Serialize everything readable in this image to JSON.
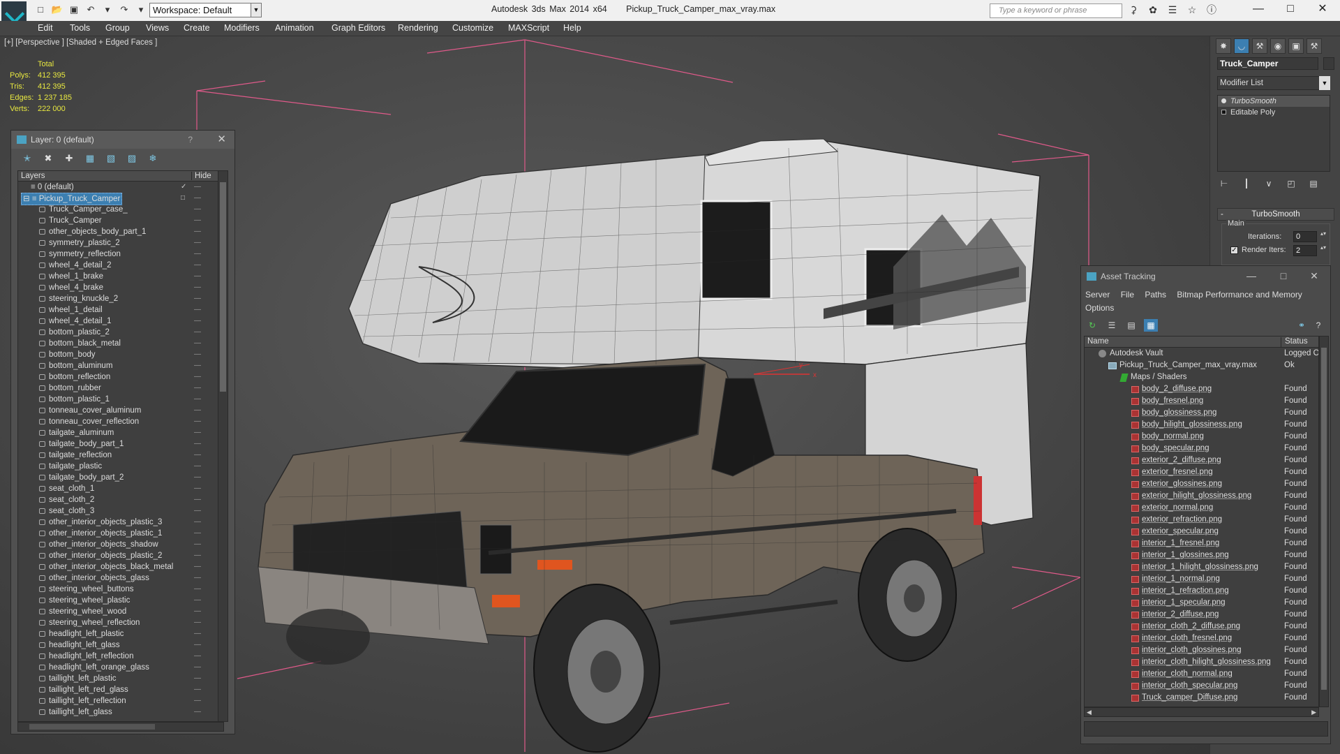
{
  "titlebar": {
    "workspace_label": "Workspace: Default",
    "app_name": "Autodesk 3ds Max  2014 x64",
    "file_name": "Pickup_Truck_Camper_max_vray.max",
    "search_placeholder": "Type a keyword or phrase"
  },
  "menu": [
    "Edit",
    "Tools",
    "Group",
    "Views",
    "Create",
    "Modifiers",
    "Animation",
    "Graph Editors",
    "Rendering",
    "Customize",
    "MAXScript",
    "Help"
  ],
  "viewport": {
    "label": "[+] [Perspective ] [Shaded + Edged Faces ]",
    "stats": {
      "header": "Total",
      "polys_label": "Polys:",
      "polys": "412 395",
      "tris_label": "Tris:",
      "tris": "412 395",
      "edges_label": "Edges:",
      "edges": "1 237 185",
      "verts_label": "Verts:",
      "verts": "222 000"
    },
    "colors": {
      "bbox": "#e05a8a",
      "body": "#6e6458",
      "camper": "#d8d8d8",
      "wire": "#2a2a2a"
    }
  },
  "layer_window": {
    "title": "Layer: 0 (default)",
    "help": "?",
    "col_layers": "Layers",
    "col_hide": "Hide",
    "default_layer": "0 (default)",
    "selected_layer": "Pickup_Truck_Camper",
    "objects": [
      "Truck_Camper_case_",
      "Truck_Camper",
      "other_objects_body_part_1",
      "symmetry_plastic_2",
      "symmetry_reflection",
      "wheel_4_detail_2",
      "wheel_1_brake",
      "wheel_4_brake",
      "steering_knuckle_2",
      "wheel_1_detail",
      "wheel_4_detail_1",
      "bottom_plastic_2",
      "bottom_black_metal",
      "bottom_body",
      "bottom_aluminum",
      "bottom_reflection",
      "bottom_rubber",
      "bottom_plastic_1",
      "tonneau_cover_aluminum",
      "tonneau_cover_reflection",
      "tailgate_aluminum",
      "tailgate_body_part_1",
      "tailgate_reflection",
      "tailgate_plastic",
      "tailgate_body_part_2",
      "seat_cloth_1",
      "seat_cloth_2",
      "seat_cloth_3",
      "other_interior_objects_plastic_3",
      "other_interior_objects_plastic_1",
      "other_interior_objects_shadow",
      "other_interior_objects_plastic_2",
      "other_interior_objects_black_metal",
      "other_interior_objects_glass",
      "steering_wheel_buttons",
      "steering_wheel_plastic",
      "steering_wheel_wood",
      "steering_wheel_reflection",
      "headlight_left_plastic",
      "headlight_left_glass",
      "headlight_left_reflection",
      "headlight_left_orange_glass",
      "taillight_left_plastic",
      "taillight_left_red_glass",
      "taillight_left_reflection",
      "taillight_left_glass"
    ]
  },
  "command_panel": {
    "object_name": "Truck_Camper",
    "modifier_list": "Modifier List",
    "stack": [
      "TurboSmooth",
      "Editable Poly"
    ],
    "rollout_title": "TurboSmooth",
    "group_main": "Main",
    "iterations_label": "Iterations:",
    "iterations_value": "0",
    "render_iters_label": "Render Iters:",
    "render_iters_value": "2"
  },
  "asset_tracking": {
    "title": "Asset Tracking",
    "menu": [
      "Server",
      "File",
      "Paths",
      "Bitmap Performance and Memory",
      "Options"
    ],
    "col_name": "Name",
    "col_status": "Status",
    "vault": {
      "name": "Autodesk Vault",
      "status": "Logged O"
    },
    "scene_file": {
      "name": "Pickup_Truck_Camper_max_vray.max",
      "status": "Ok"
    },
    "group": "Maps / Shaders",
    "files": [
      {
        "name": "body_2_diffuse.png",
        "status": "Found"
      },
      {
        "name": "body_fresnel.png",
        "status": "Found"
      },
      {
        "name": "body_glossiness.png",
        "status": "Found"
      },
      {
        "name": "body_hilight_glossiness.png",
        "status": "Found"
      },
      {
        "name": "body_normal.png",
        "status": "Found"
      },
      {
        "name": "body_specular.png",
        "status": "Found"
      },
      {
        "name": "exterior_2_diffuse.png",
        "status": "Found"
      },
      {
        "name": "exterior_fresnel.png",
        "status": "Found"
      },
      {
        "name": "exterior_glossines.png",
        "status": "Found"
      },
      {
        "name": "exterior_hilight_glossiness.png",
        "status": "Found"
      },
      {
        "name": "exterior_normal.png",
        "status": "Found"
      },
      {
        "name": "exterior_refraction.png",
        "status": "Found"
      },
      {
        "name": "exterior_specular.png",
        "status": "Found"
      },
      {
        "name": "interior_1_fresnel.png",
        "status": "Found"
      },
      {
        "name": "interior_1_glossines.png",
        "status": "Found"
      },
      {
        "name": "interior_1_hilight_glossiness.png",
        "status": "Found"
      },
      {
        "name": "interior_1_normal.png",
        "status": "Found"
      },
      {
        "name": "interior_1_refraction.png",
        "status": "Found"
      },
      {
        "name": "interior_1_specular.png",
        "status": "Found"
      },
      {
        "name": "interior_2_diffuse.png",
        "status": "Found"
      },
      {
        "name": "interior_cloth_2_diffuse.png",
        "status": "Found"
      },
      {
        "name": "interior_cloth_fresnel.png",
        "status": "Found"
      },
      {
        "name": "interior_cloth_glossines.png",
        "status": "Found"
      },
      {
        "name": "interior_cloth_hilight_glossiness.png",
        "status": "Found"
      },
      {
        "name": "interior_cloth_normal.png",
        "status": "Found"
      },
      {
        "name": "interior_cloth_specular.png",
        "status": "Found"
      },
      {
        "name": "Truck_camper_Diffuse.png",
        "status": "Found"
      }
    ]
  }
}
